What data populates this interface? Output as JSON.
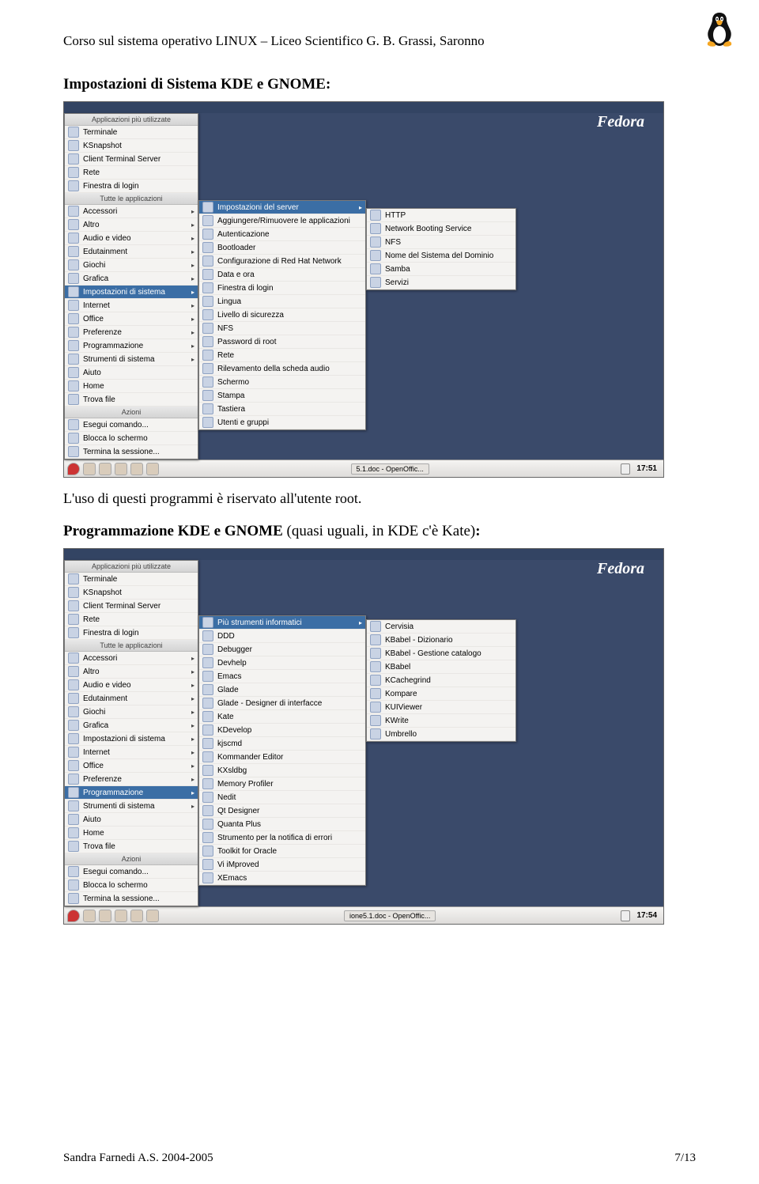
{
  "page": {
    "header": "Corso sul sistema operativo LINUX – Liceo Scientifico G. B. Grassi, Saronno",
    "title1": "Impostazioni di Sistema KDE e GNOME:",
    "body1": "L'uso di questi programmi è riservato all'utente root.",
    "title2": "Programmazione KDE e GNOME",
    "title2_suffix": " (quasi uguali, in KDE c'è Kate)",
    "title2_colon": ":",
    "footer_left": "Sandra Farnedi     A.S. 2004-2005",
    "footer_right": "7/13"
  },
  "shot1": {
    "fedora": "Fedora",
    "hdr_top": "Applicazioni più utilizzate",
    "top_apps": [
      "Terminale",
      "KSnapshot",
      "Client Terminal Server",
      "Rete",
      "Finestra di login"
    ],
    "hdr_all": "Tutte le applicazioni",
    "categories": [
      {
        "label": "Accessori",
        "sub": true
      },
      {
        "label": "Altro",
        "sub": true
      },
      {
        "label": "Audio e video",
        "sub": true
      },
      {
        "label": "Edutainment",
        "sub": true
      },
      {
        "label": "Giochi",
        "sub": true
      },
      {
        "label": "Grafica",
        "sub": true
      },
      {
        "label": "Impostazioni di sistema",
        "sub": true,
        "selected": true
      },
      {
        "label": "Internet",
        "sub": true
      },
      {
        "label": "Office",
        "sub": true
      },
      {
        "label": "Preferenze",
        "sub": true
      },
      {
        "label": "Programmazione",
        "sub": true
      },
      {
        "label": "Strumenti di sistema",
        "sub": true
      },
      {
        "label": "Aiuto",
        "sub": false
      },
      {
        "label": "Home",
        "sub": false
      },
      {
        "label": "Trova file",
        "sub": false
      }
    ],
    "hdr_actions": "Azioni",
    "actions": [
      "Esegui comando...",
      "Blocca lo schermo",
      "Termina la sessione..."
    ],
    "sub1": [
      {
        "label": "Impostazioni del server",
        "sub": true,
        "selected": true
      },
      {
        "label": "Aggiungere/Rimuovere le applicazioni"
      },
      {
        "label": "Autenticazione"
      },
      {
        "label": "Bootloader"
      },
      {
        "label": "Configurazione di Red Hat Network"
      },
      {
        "label": "Data e ora"
      },
      {
        "label": "Finestra di login"
      },
      {
        "label": "Lingua"
      },
      {
        "label": "Livello di sicurezza"
      },
      {
        "label": "NFS"
      },
      {
        "label": "Password di root"
      },
      {
        "label": "Rete"
      },
      {
        "label": "Rilevamento della scheda audio"
      },
      {
        "label": "Schermo"
      },
      {
        "label": "Stampa"
      },
      {
        "label": "Tastiera"
      },
      {
        "label": "Utenti e gruppi"
      }
    ],
    "sub2": [
      "HTTP",
      "Network Booting Service",
      "NFS",
      "Nome del Sistema del Dominio",
      "Samba",
      "Servizi"
    ],
    "task_btn": "5.1.doc - OpenOffic...",
    "clock": "17:51"
  },
  "shot2": {
    "fedora": "Fedora",
    "hdr_top": "Applicazioni più utilizzate",
    "top_apps": [
      "Terminale",
      "KSnapshot",
      "Client Terminal Server",
      "Rete",
      "Finestra di login"
    ],
    "hdr_all": "Tutte le applicazioni",
    "categories": [
      {
        "label": "Accessori",
        "sub": true
      },
      {
        "label": "Altro",
        "sub": true
      },
      {
        "label": "Audio e video",
        "sub": true
      },
      {
        "label": "Edutainment",
        "sub": true
      },
      {
        "label": "Giochi",
        "sub": true
      },
      {
        "label": "Grafica",
        "sub": true
      },
      {
        "label": "Impostazioni di sistema",
        "sub": true
      },
      {
        "label": "Internet",
        "sub": true
      },
      {
        "label": "Office",
        "sub": true
      },
      {
        "label": "Preferenze",
        "sub": true
      },
      {
        "label": "Programmazione",
        "sub": true,
        "selected": true
      },
      {
        "label": "Strumenti di sistema",
        "sub": true
      },
      {
        "label": "Aiuto",
        "sub": false
      },
      {
        "label": "Home",
        "sub": false
      },
      {
        "label": "Trova file",
        "sub": false
      }
    ],
    "hdr_actions": "Azioni",
    "actions": [
      "Esegui comando...",
      "Blocca lo schermo",
      "Termina la sessione..."
    ],
    "sub1": [
      {
        "label": "Più strumenti informatici",
        "sub": true,
        "selected": true
      },
      {
        "label": "DDD"
      },
      {
        "label": "Debugger"
      },
      {
        "label": "Devhelp"
      },
      {
        "label": "Emacs"
      },
      {
        "label": "Glade"
      },
      {
        "label": "Glade - Designer di interfacce"
      },
      {
        "label": "Kate"
      },
      {
        "label": "KDevelop"
      },
      {
        "label": "kjscmd"
      },
      {
        "label": "Kommander Editor"
      },
      {
        "label": "KXsldbg"
      },
      {
        "label": "Memory Profiler"
      },
      {
        "label": "Nedit"
      },
      {
        "label": "Qt Designer"
      },
      {
        "label": "Quanta Plus"
      },
      {
        "label": "Strumento per la notifica di errori"
      },
      {
        "label": "Toolkit for Oracle"
      },
      {
        "label": "Vi iMproved"
      },
      {
        "label": "XEmacs"
      }
    ],
    "sub2": [
      "Cervisia",
      "KBabel - Dizionario",
      "KBabel - Gestione catalogo",
      "KBabel",
      "KCachegrind",
      "Kompare",
      "KUIViewer",
      "KWrite",
      "Umbrello"
    ],
    "task_btn": "ione5.1.doc - OpenOffic...",
    "clock": "17:54"
  }
}
